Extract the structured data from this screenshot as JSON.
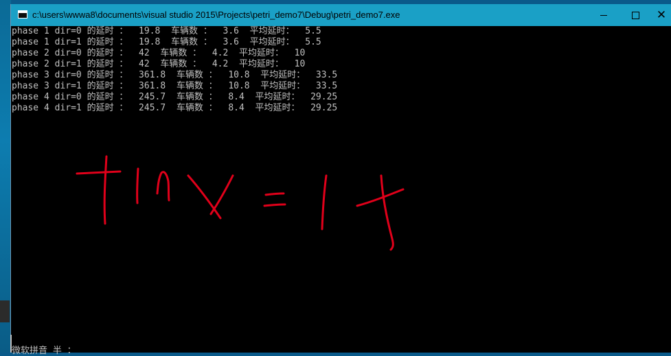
{
  "window": {
    "title": "c:\\users\\wwwa8\\documents\\visual studio 2015\\Projects\\petri_demo7\\Debug\\petri_demo7.exe",
    "controls": {
      "minimize": "minimize",
      "maximize": "maximize",
      "close": "✕"
    }
  },
  "console": {
    "lines": [
      "phase 1 dir=0 的延时 ：  19.8  车辆数 ：  3.6  平均延时：  5.5",
      "phase 1 dir=1 的延时 ：  19.8  车辆数 ：  3.6  平均延时：  5.5",
      "phase 2 dir=0 的延时 ：  42  车辆数 ：  4.2  平均延时：  10",
      "phase 2 dir=1 的延时 ：  42  车辆数 ：  4.2  平均延时：  10",
      "phase 3 dir=0 的延时 ：  361.8  车辆数 ：  10.8  平均延时：  33.5",
      "phase 3 dir=1 的延时 ：  361.8  车辆数 ：  10.8  平均延时：  33.5",
      "phase 4 dir=0 的延时 ：  245.7  车辆数 ：  8.4  平均延时：  29.25",
      "phase 4 dir=1 的延时 ：  245.7  车辆数 ：  8.4  平均延时：  29.25"
    ],
    "ime_status": "微软拼音 半 ：",
    "ink_color": "#e0001a",
    "annotation": "tlnx=1+"
  }
}
